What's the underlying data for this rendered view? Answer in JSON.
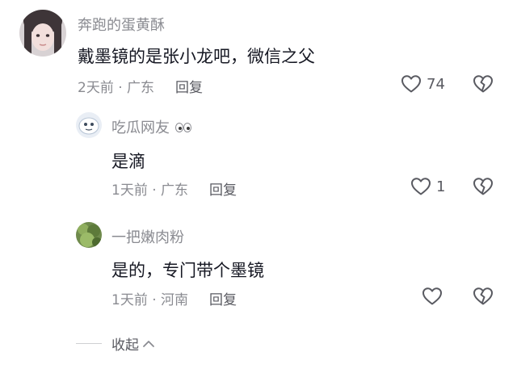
{
  "comments": [
    {
      "username": "奔跑的蛋黄酥",
      "text": "戴墨镜的是张小龙吧，微信之父",
      "time": "2天前",
      "location": "广东",
      "reply_label": "回复",
      "likes": "74"
    }
  ],
  "replies": [
    {
      "username": "吃瓜网友",
      "username_emoji": "👀",
      "text": "是滴",
      "time": "1天前",
      "location": "广东",
      "reply_label": "回复",
      "likes": "1"
    },
    {
      "username": "一把嫩肉粉",
      "text": "是的，专门带个墨镜",
      "time": "1天前",
      "location": "河南",
      "reply_label": "回复",
      "likes": ""
    }
  ],
  "collapse_label": "收起",
  "icons": {
    "like": "heart-outline-icon",
    "dislike": "broken-heart-icon",
    "collapse": "chevron-up-icon"
  },
  "colors": {
    "primary_text": "#161823",
    "secondary_text": "#8a8b91",
    "icon": "#595a61"
  }
}
